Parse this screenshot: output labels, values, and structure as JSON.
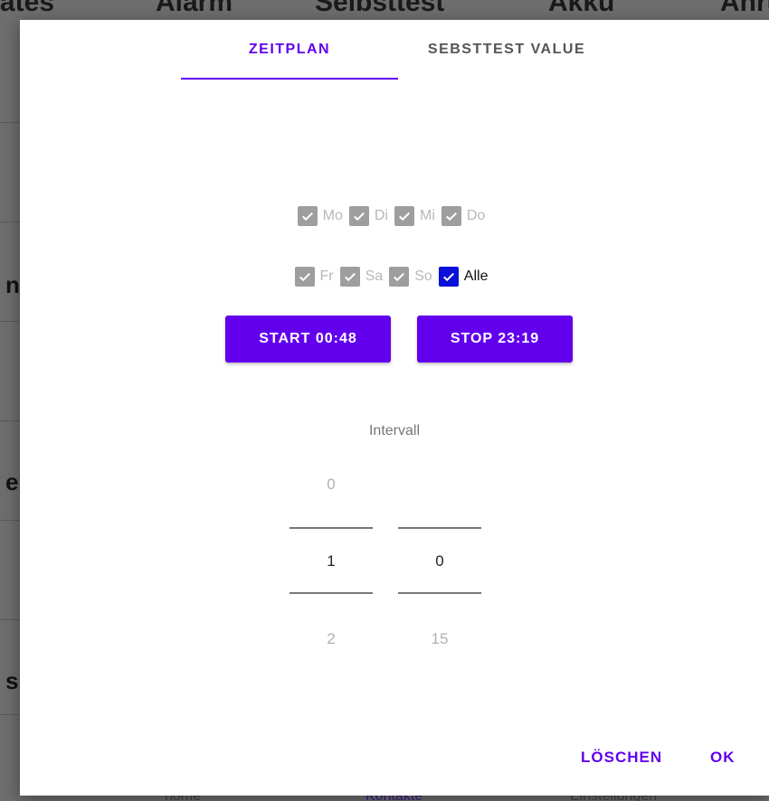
{
  "background": {
    "header_cols": [
      "ätes",
      "Alarm",
      "Selbsttest",
      "Akku",
      "Anru"
    ],
    "side_letters": [
      "n",
      "e",
      "s"
    ],
    "bottom_nav": [
      "home",
      "Kontakte",
      "Einstellungen"
    ]
  },
  "dialog": {
    "tabs": [
      {
        "label": "ZEITPLAN",
        "active": true
      },
      {
        "label": "SEBSTTEST VALUE",
        "active": false
      }
    ],
    "days_row1": [
      {
        "label": "Mo",
        "checked": true
      },
      {
        "label": "Di",
        "checked": true
      },
      {
        "label": "Mi",
        "checked": true
      },
      {
        "label": "Do",
        "checked": true
      }
    ],
    "days_row2": [
      {
        "label": "Fr",
        "checked": true
      },
      {
        "label": "Sa",
        "checked": true
      },
      {
        "label": "So",
        "checked": true
      },
      {
        "label": "Alle",
        "checked": true
      }
    ],
    "start_button": "START 00:48",
    "stop_button": "STOP 23:19",
    "interval_label": "Intervall",
    "picker_left": {
      "prev": "0",
      "current": "1",
      "next": "2"
    },
    "picker_right": {
      "prev": "",
      "current": "0",
      "next": "15"
    },
    "actions": {
      "delete": "LÖSCHEN",
      "ok": "OK"
    }
  },
  "colors": {
    "accent": "#6200ee",
    "checkbox_active": "#0a10d8",
    "checkbox_disabled": "#9e9e9e"
  },
  "icons": {
    "checkbox": "check-icon"
  }
}
